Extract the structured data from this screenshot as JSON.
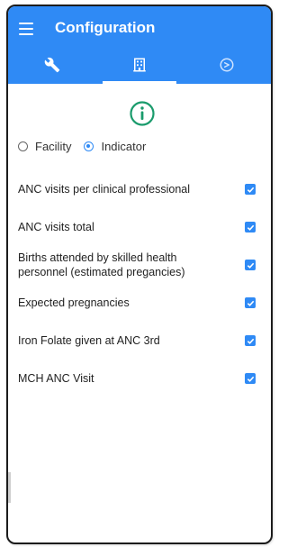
{
  "app": {
    "title": "Configuration"
  },
  "tabs": [
    {
      "name": "settings",
      "icon": "wrench-icon"
    },
    {
      "name": "organisation",
      "icon": "building-icon",
      "active": true
    },
    {
      "name": "period",
      "icon": "clock-icon"
    }
  ],
  "selection": {
    "options": [
      {
        "label": "Facility",
        "checked": false
      },
      {
        "label": "Indicator",
        "checked": true
      }
    ]
  },
  "indicators": [
    {
      "label": "ANC visits per clinical professional",
      "checked": true
    },
    {
      "label": "ANC visits total",
      "checked": true
    },
    {
      "label": "Births attended by skilled health personnel (estimated pregancies)",
      "checked": true
    },
    {
      "label": "Expected pregnancies",
      "checked": true
    },
    {
      "label": "Iron Folate given at ANC 3rd",
      "checked": true
    },
    {
      "label": "MCH ANC Visit",
      "checked": true
    }
  ],
  "colors": {
    "primary": "#2f8af5",
    "info": "#1a9b6c"
  }
}
